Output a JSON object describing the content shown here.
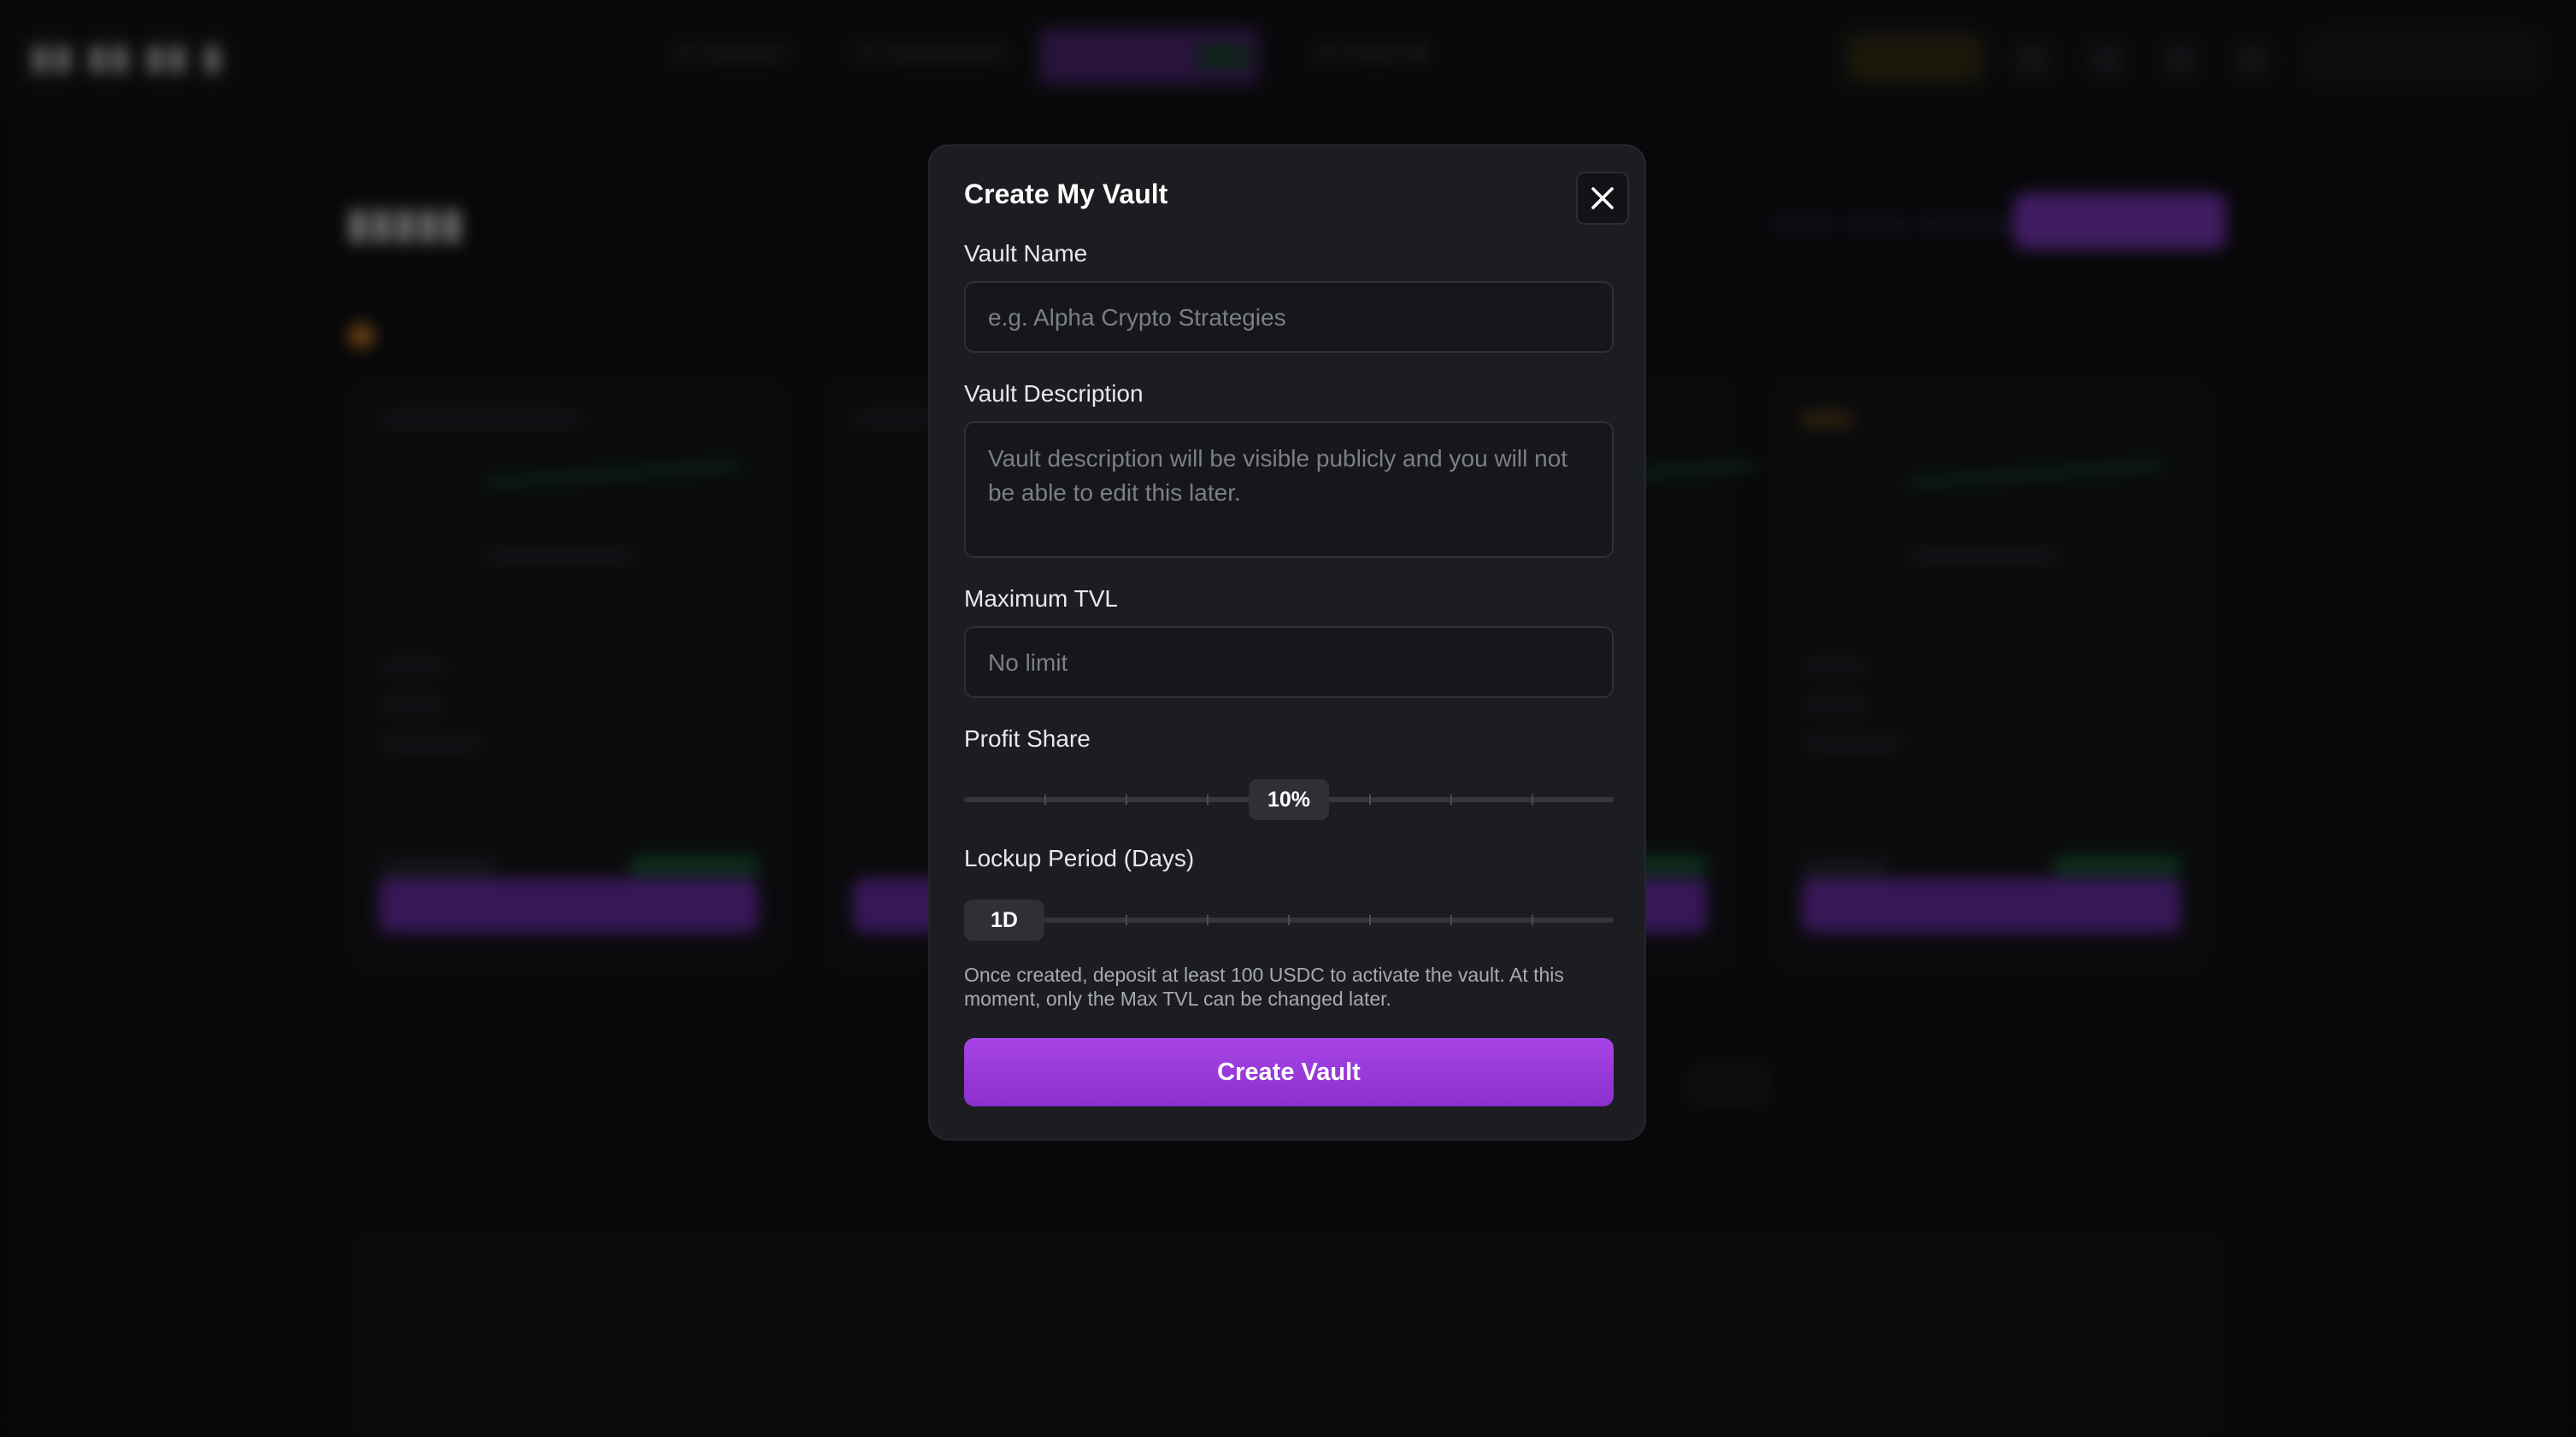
{
  "modal": {
    "title": "Create My Vault",
    "close_icon": "close-icon",
    "vault_name": {
      "label": "Vault Name",
      "placeholder": "e.g. Alpha Crypto Strategies",
      "value": ""
    },
    "vault_description": {
      "label": "Vault Description",
      "placeholder": "Vault description will be visible publicly and you will not be able to edit this later.",
      "value": ""
    },
    "max_tvl": {
      "label": "Maximum TVL",
      "placeholder": "No limit",
      "value": ""
    },
    "profit_share": {
      "label": "Profit Share",
      "value_label": "10%",
      "value": 10
    },
    "lockup_period": {
      "label": "Lockup Period (Days)",
      "value_label": "1D",
      "value": 1
    },
    "note": "Once created, deposit at least 100 USDC to activate the vault. At this moment, only the Max TVL can be changed later.",
    "submit_label": "Create Vault"
  },
  "colors": {
    "accent": "#9b3fe0",
    "modal_bg": "#1c1d21",
    "page_bg": "#0d0e11"
  }
}
